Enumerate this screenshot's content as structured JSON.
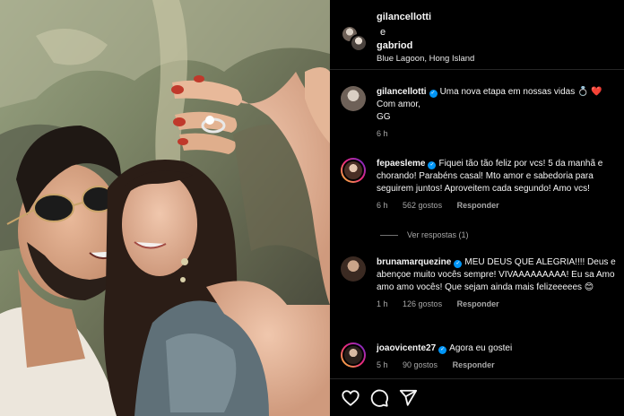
{
  "post": {
    "author1": "gilancellotti",
    "conjunction": "e",
    "author2": "gabriod",
    "location": "Blue Lagoon, Hong Island"
  },
  "comments": [
    {
      "username": "gilancellotti",
      "verified": true,
      "text": "Uma nova etapa em nossas vidas 💍 ❤️",
      "text_line2": "Com amor,",
      "text_line3": "GG",
      "time": "6 h"
    },
    {
      "username": "fepaesleme",
      "verified": true,
      "text": "Fiquei tão tão feliz por vcs! 5 da manhã e chorando! Parabéns casal! Mto amor e sabedoria para seguirem juntos! Aproveitem cada segundo! Amo vcs!",
      "time": "6 h",
      "likes": "562 gostos",
      "reply": "Responder",
      "view_replies": "Ver respostas (1)"
    },
    {
      "username": "brunamarquezine",
      "verified": true,
      "text": "MEU DEUS QUE ALEGRIA!!!! Deus e abençoe muito vocês sempre! VIVAAAAAAAAA! Eu sa Amo amo amo vocês! Que sejam ainda mais felizeeeees 😊",
      "time": "1 h",
      "likes": "126 gostos",
      "reply": "Responder"
    },
    {
      "username": "joaovicente27",
      "verified": true,
      "text": "Agora eu gostei",
      "time": "5 h",
      "likes": "90 gostos",
      "reply": "Responder"
    }
  ],
  "actions": {
    "like_icon": "heart-icon",
    "comment_icon": "comment-icon",
    "share_icon": "share-icon"
  },
  "colors": {
    "background": "#000000",
    "verified": "#0095f6",
    "muted_text": "#a8a8a8",
    "heart": "#ed4956"
  }
}
